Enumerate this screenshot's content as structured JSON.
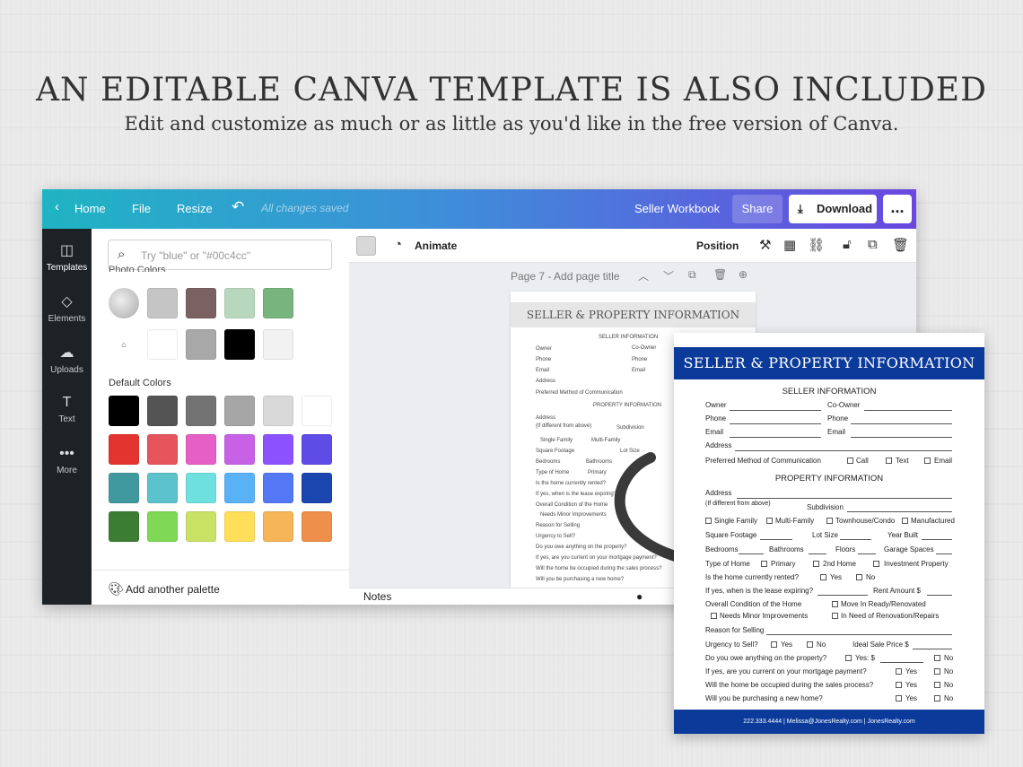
{
  "hero": {
    "title": "AN EDITABLE CANVA TEMPLATE IS ALSO INCLUDED",
    "subtitle": "Edit and customize as much or as little as you'd like in the free version of Canva."
  },
  "topbar": {
    "home": "Home",
    "file": "File",
    "resize": "Resize",
    "undo_icon": "undo-icon",
    "saved_status": "All changes saved",
    "doc_title": "Seller Workbook",
    "share": "Share",
    "download": "Download",
    "more": "..."
  },
  "sidebar": {
    "items": [
      {
        "label": "Templates",
        "icon": "templates-icon"
      },
      {
        "label": "Elements",
        "icon": "elements-icon"
      },
      {
        "label": "Uploads",
        "icon": "uploads-icon"
      },
      {
        "label": "Text",
        "icon": "text-icon"
      },
      {
        "label": "More",
        "icon": "more-icon"
      }
    ]
  },
  "panel": {
    "search_placeholder": "Try \"blue\" or \"#00c4cc\"",
    "photo_colors_label": "Photo Colors",
    "photo_colors": [
      "#c5c5c5",
      "#7a6262",
      "#b8d8be",
      "#78b57e",
      "#ffffff",
      "#a8a8a8",
      "#000000",
      "#f2f2f2"
    ],
    "default_colors_label": "Default Colors",
    "default_colors": [
      "#000000",
      "#545454",
      "#737373",
      "#a6a6a6",
      "#d9d9d9",
      "#ffffff",
      "#e3342f",
      "#e5555b",
      "#e55fc7",
      "#c762e6",
      "#8c52ff",
      "#5e4ce6",
      "#40999f",
      "#5cc2cb",
      "#6fe0e0",
      "#58b2f5",
      "#5478f5",
      "#1b46b0",
      "#3a7d33",
      "#7fd856",
      "#c9e265",
      "#ffde59",
      "#f6b556",
      "#ee8f4b"
    ],
    "add_palette": "Add another palette"
  },
  "toolbar": {
    "animate": "Animate",
    "position": "Position"
  },
  "canvas": {
    "page_title": "Page 7 - Add page title",
    "notes": "Notes"
  },
  "doc": {
    "title": "SELLER & PROPERTY INFORMATION",
    "seller_section": "SELLER INFORMATION",
    "owner": "Owner",
    "co_owner": "Co-Owner",
    "phone": "Phone",
    "email": "Email",
    "address": "Address",
    "preferred": "Preferred Method of Communication",
    "call": "Call",
    "text": "Text",
    "email_opt": "Email",
    "property_section": "PROPERTY INFORMATION",
    "if_different": "(If different from above)",
    "subdivision": "Subdivision",
    "single_family": "Single Family",
    "multi_family": "Multi-Family",
    "townhouse": "Townhouse/Condo",
    "manufactured": "Manufactured",
    "square_footage": "Square Footage",
    "lot_size": "Lot Size",
    "year_built": "Year Built",
    "bedrooms": "Bedrooms",
    "bathrooms": "Bathrooms",
    "floors": "Floors",
    "garage": "Garage Spaces",
    "type_of_home": "Type of Home",
    "primary": "Primary",
    "second_home": "2nd Home",
    "investment": "Investment Property",
    "rented_q": "Is the home currently rented?",
    "yes": "Yes",
    "no": "No",
    "lease_q": "If yes, when is the lease expiring?",
    "rent_amount": "Rent Amount  $",
    "condition": "Overall Condition of the Home",
    "move_in": "Move In Ready/Renovated",
    "needs_minor": "Needs Minor Improvements",
    "needs_renov": "In Need of Renovation/Repairs",
    "reason": "Reason for Selling",
    "urgency": "Urgency to Sell?",
    "ideal_price": "Ideal Sale Price $",
    "owe_q": "Do you owe anything on the property?",
    "yes_dollar": "Yes:  $",
    "mortgage_q": "If yes, are you current on your mortgage payment?",
    "occupied_q": "Will the home be occupied during the sales process?",
    "purchasing_q": "Will you be purchasing a new home?",
    "footer": "222.333.4444  |  Melissa@JonesRealty.com  |  JonesRealty.com"
  },
  "colors": {
    "doc_blue": "#0b3a9a",
    "sidebar_dark": "#1d2226"
  }
}
